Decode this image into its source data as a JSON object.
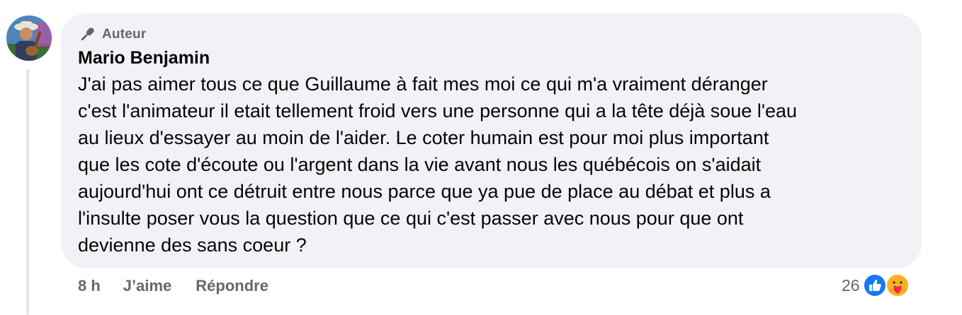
{
  "comment": {
    "badge_label": "Auteur",
    "badge_icon": "microphone-icon",
    "author_name": "Mario Benjamin",
    "avatar_icon": "user-avatar",
    "text_lines": [
      "J'ai pas aimer tous ce que Guillaume à fait mes moi ce qui m'a vraiment déranger",
      "c'est l'animateur il etait tellement froid vers une personne qui a la tête déjà soue l'eau",
      "au lieux d'essayer au moin de l'aider. Le coter humain est pour moi plus important",
      "que les cote d'écoute ou l'argent dans la vie avant nous les québécois on s'aidait",
      "aujourd'hui ont ce détruit entre nous parce que ya pue de place au débat et plus a",
      "l'insulte poser vous la question que ce qui c'est passer avec nous pour que ont",
      "devienne des sans coeur ?"
    ]
  },
  "actions": {
    "time": "8 h",
    "like_label": "J’aime",
    "reply_label": "Répondre"
  },
  "reactions": {
    "count": "26",
    "icons": [
      "like-reaction-icon",
      "care-reaction-icon"
    ],
    "like_color": "#1877f2",
    "care_color": "#f7b125"
  },
  "colors": {
    "bubble_bg": "#f0f2f5",
    "secondary_text": "#65676b",
    "primary_text": "#050505"
  }
}
